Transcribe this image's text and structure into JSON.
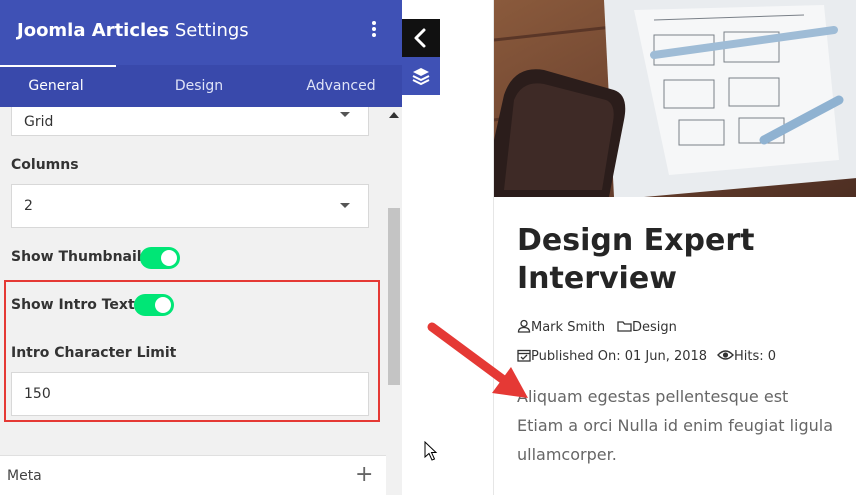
{
  "panel": {
    "title_bold": "Joomla Articles",
    "title_rest": " Settings",
    "tabs": [
      {
        "label": "General",
        "active": true
      },
      {
        "label": "Design",
        "active": false
      },
      {
        "label": "Advanced",
        "active": false
      }
    ],
    "layout_select": {
      "value": "Grid"
    },
    "columns": {
      "label": "Columns",
      "value": "2"
    },
    "show_thumbnail": {
      "label": "Show Thumbnail",
      "on": true
    },
    "show_intro_text": {
      "label": "Show Intro Text",
      "on": true
    },
    "intro_limit": {
      "label": "Intro Character Limit",
      "value": "150"
    },
    "meta_section": {
      "label": "Meta"
    }
  },
  "preview": {
    "title": "Design Expert Interview",
    "author": "Mark Smith",
    "category": "Design",
    "published": "Published On: 01 Jun, 2018",
    "hits": "Hits: 0",
    "intro": "Aliquam egestas pellentesque est Etiam a orci Nulla id enim feugiat ligula ullamcorper."
  },
  "colors": {
    "header": "#3f51b5",
    "tabs": "#3949ab",
    "toggle_on": "#00e676",
    "highlight": "#e53935"
  },
  "icons": [
    "kebab-menu-icon",
    "chevron-left-icon",
    "layers-icon",
    "user-icon",
    "folder-icon",
    "calendar-icon",
    "eye-icon",
    "plus-icon",
    "cursor-icon",
    "red-arrow"
  ]
}
